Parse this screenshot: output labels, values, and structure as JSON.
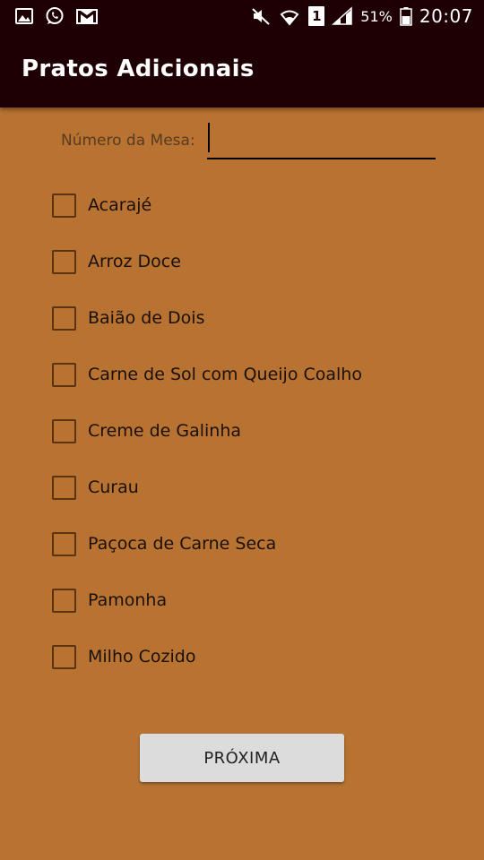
{
  "status_bar": {
    "left_icons": [
      "gallery-icon",
      "whatsapp-icon",
      "gmail-icon"
    ],
    "right_icons": [
      "mute-icon",
      "wifi-icon",
      "signal-icon",
      "battery-icon"
    ],
    "sim_slot": "1",
    "battery": "51%",
    "time": "20:07"
  },
  "app_bar": {
    "title": "Pratos Adicionais"
  },
  "table_field": {
    "label": "Número da Mesa:",
    "value": ""
  },
  "dishes": [
    {
      "label": "Acarajé",
      "checked": false
    },
    {
      "label": "Arroz Doce",
      "checked": false
    },
    {
      "label": "Baião de Dois",
      "checked": false
    },
    {
      "label": "Carne de Sol com Queijo Coalho",
      "checked": false
    },
    {
      "label": "Creme de Galinha",
      "checked": false
    },
    {
      "label": "Curau",
      "checked": false
    },
    {
      "label": "Paçoca de Carne Seca",
      "checked": false
    },
    {
      "label": "Pamonha",
      "checked": false
    },
    {
      "label": "Milho Cozido",
      "checked": false
    }
  ],
  "next_button": {
    "label": "PRÓXIMA"
  },
  "colors": {
    "app_bar": "#1e0004",
    "background": "#b87333",
    "checkbox_border": "#5c3311",
    "button_bg": "#dcdcdc"
  }
}
